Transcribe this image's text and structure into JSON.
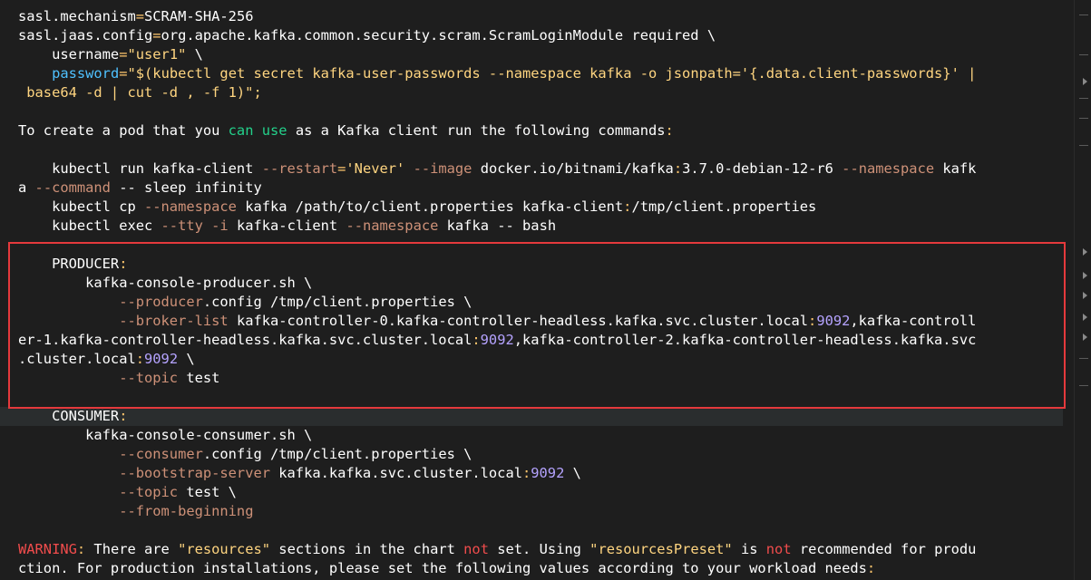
{
  "terminal": {
    "lines": [
      {
        "segs": [
          [
            "k",
            "sasl.mechanism"
          ],
          [
            "o",
            "="
          ],
          [
            "k",
            "SCRAM-SHA-256"
          ]
        ]
      },
      {
        "segs": [
          [
            "k",
            "sasl.jaas.config"
          ],
          [
            "o",
            "="
          ],
          [
            "k",
            "org.apache.kafka.common.security.scram.ScramLoginModule required \\"
          ]
        ]
      },
      {
        "segs": [
          [
            "k",
            "    username"
          ],
          [
            "o",
            "="
          ],
          [
            "str",
            "\"user1\""
          ],
          [
            "k",
            " \\"
          ]
        ]
      },
      {
        "segs": [
          [
            "k",
            "    "
          ],
          [
            "pw",
            "password"
          ],
          [
            "o",
            "="
          ],
          [
            "str",
            "\"$(kubectl get secret kafka-user-passwords --namespace kafka -o jsonpath='{.data.client-passwords}' |"
          ]
        ],
        "wrap": true
      },
      {
        "segs": [
          [
            "str",
            " base64 -d | cut -d , -f 1)\";"
          ]
        ]
      },
      {
        "segs": []
      },
      {
        "segs": [
          [
            "k",
            "To create a pod that you "
          ],
          [
            "g",
            "can"
          ],
          [
            "k",
            " "
          ],
          [
            "g",
            "use"
          ],
          [
            "k",
            " as a Kafka client run the following commands"
          ],
          [
            "o",
            ":"
          ]
        ]
      },
      {
        "segs": []
      },
      {
        "segs": [
          [
            "k",
            "    kubectl run kafka-client "
          ],
          [
            "opt",
            "--restart"
          ],
          [
            "o",
            "="
          ],
          [
            "str",
            "'Never'"
          ],
          [
            "k",
            " "
          ],
          [
            "opt",
            "--image"
          ],
          [
            "k",
            " docker.io/bitnami/kafka"
          ],
          [
            "o",
            ":"
          ],
          [
            "k",
            "3.7.0-debian-12-r6 "
          ],
          [
            "opt",
            "--namespace"
          ],
          [
            "k",
            " kafk"
          ]
        ],
        "wrap": true
      },
      {
        "segs": [
          [
            "k",
            "a "
          ],
          [
            "opt",
            "--command"
          ],
          [
            "k",
            " -- sleep infinity"
          ]
        ]
      },
      {
        "segs": [
          [
            "k",
            "    kubectl cp "
          ],
          [
            "opt",
            "--namespace"
          ],
          [
            "k",
            " kafka /path/to/client.properties kafka-client"
          ],
          [
            "o",
            ":"
          ],
          [
            "k",
            "/tmp/client.properties"
          ]
        ]
      },
      {
        "segs": [
          [
            "k",
            "    kubectl exec "
          ],
          [
            "opt",
            "--tty"
          ],
          [
            "k",
            " "
          ],
          [
            "opt",
            "-i"
          ],
          [
            "k",
            " kafka-client "
          ],
          [
            "opt",
            "--namespace"
          ],
          [
            "k",
            " kafka -- bash"
          ]
        ]
      },
      {
        "segs": []
      },
      {
        "segs": [
          [
            "k",
            "    PRODUCER"
          ],
          [
            "o",
            ":"
          ]
        ]
      },
      {
        "segs": [
          [
            "k",
            "        kafka-console-producer.sh \\"
          ]
        ]
      },
      {
        "segs": [
          [
            "k",
            "            "
          ],
          [
            "opt",
            "--producer"
          ],
          [
            "k",
            ".config /tmp/client.properties \\"
          ]
        ]
      },
      {
        "segs": [
          [
            "k",
            "            "
          ],
          [
            "opt",
            "--broker-list"
          ],
          [
            "k",
            " kafka-controller-0.kafka-controller-headless.kafka.svc.cluster.local"
          ],
          [
            "o",
            ":"
          ],
          [
            "num",
            "9092"
          ],
          [
            "k",
            ",kafka-controll"
          ]
        ],
        "wrap": true
      },
      {
        "segs": [
          [
            "k",
            "er-1.kafka-controller-headless.kafka.svc.cluster.local"
          ],
          [
            "o",
            ":"
          ],
          [
            "num",
            "9092"
          ],
          [
            "k",
            ",kafka-controller-2.kafka-controller-headless.kafka.svc"
          ]
        ],
        "wrap": true
      },
      {
        "segs": [
          [
            "k",
            ".cluster.local"
          ],
          [
            "o",
            ":"
          ],
          [
            "num",
            "9092"
          ],
          [
            "k",
            " \\"
          ]
        ]
      },
      {
        "segs": [
          [
            "k",
            "            "
          ],
          [
            "opt",
            "--topic"
          ],
          [
            "k",
            " test"
          ]
        ]
      },
      {
        "segs": []
      },
      {
        "segs": [
          [
            "k",
            "    CONSUMER"
          ],
          [
            "o",
            ":"
          ]
        ],
        "hl": true
      },
      {
        "segs": [
          [
            "k",
            "        kafka-console-consumer.sh \\"
          ]
        ]
      },
      {
        "segs": [
          [
            "k",
            "            "
          ],
          [
            "opt",
            "--consumer"
          ],
          [
            "k",
            ".config /tmp/client.properties \\"
          ]
        ]
      },
      {
        "segs": [
          [
            "k",
            "            "
          ],
          [
            "opt",
            "--bootstrap-server"
          ],
          [
            "k",
            " kafka.kafka.svc.cluster.local"
          ],
          [
            "o",
            ":"
          ],
          [
            "num",
            "9092"
          ],
          [
            "k",
            " \\"
          ]
        ]
      },
      {
        "segs": [
          [
            "k",
            "            "
          ],
          [
            "opt",
            "--topic"
          ],
          [
            "k",
            " test \\"
          ]
        ]
      },
      {
        "segs": [
          [
            "k",
            "            "
          ],
          [
            "opt",
            "--from-beginning"
          ]
        ]
      },
      {
        "segs": []
      },
      {
        "segs": [
          [
            "red",
            "WARNING"
          ],
          [
            "o",
            ":"
          ],
          [
            "k",
            " There are "
          ],
          [
            "str",
            "\"resources\""
          ],
          [
            "k",
            " sections in the chart "
          ],
          [
            "red",
            "not"
          ],
          [
            "k",
            " set. Using "
          ],
          [
            "str",
            "\"resourcesPreset\""
          ],
          [
            "k",
            " is "
          ],
          [
            "red",
            "not"
          ],
          [
            "k",
            " recommended for produ"
          ]
        ],
        "wrap": true
      },
      {
        "segs": [
          [
            "k",
            "ction. For production installations, please set the following values according to your workload needs"
          ],
          [
            "o",
            ":"
          ]
        ]
      }
    ]
  }
}
